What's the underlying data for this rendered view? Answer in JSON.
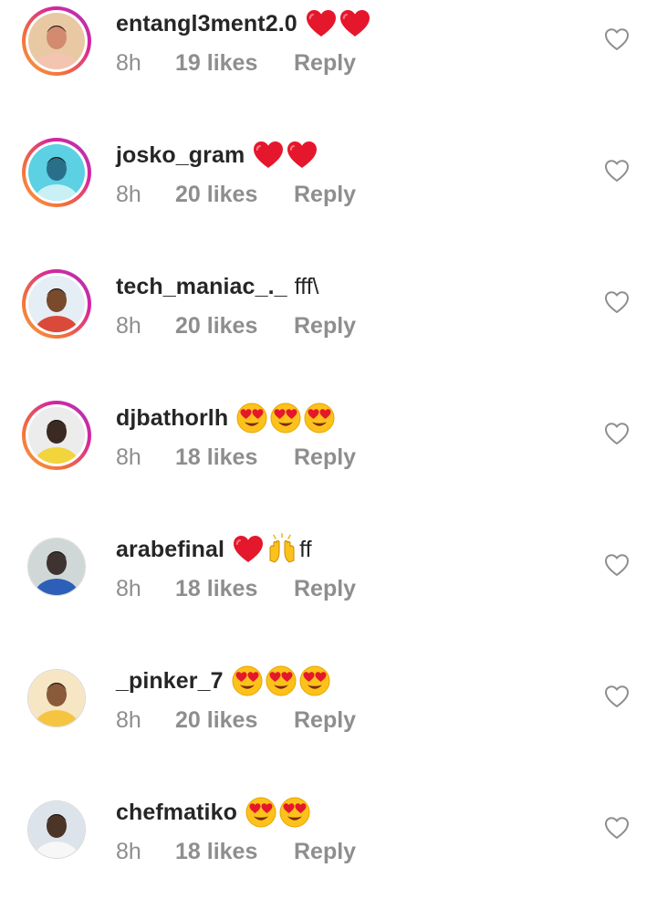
{
  "comments": [
    {
      "username": "entangl3ment2.0",
      "emojis": [
        "red-heart",
        "red-heart"
      ],
      "text_after": "",
      "time": "8h",
      "likes": "19 likes",
      "reply": "Reply",
      "story_ring": true,
      "avatar_colors": [
        "#e9c9a4",
        "#d28b6f",
        "#f3c5b0"
      ]
    },
    {
      "username": "josko_gram",
      "emojis": [
        "red-heart",
        "red-heart"
      ],
      "text_after": "",
      "time": "8h",
      "likes": "20 likes",
      "reply": "Reply",
      "story_ring": true,
      "avatar_colors": [
        "#5bd1e3",
        "#2a6f8a",
        "#c9f0f5"
      ]
    },
    {
      "username": "tech_maniac_._",
      "emojis": [],
      "text_after": "fff\\",
      "time": "8h",
      "likes": "20 likes",
      "reply": "Reply",
      "story_ring": true,
      "avatar_colors": [
        "#e6eef5",
        "#7a4a2c",
        "#d94a3a"
      ]
    },
    {
      "username": "djbathorlh",
      "emojis": [
        "heart-eyes-face",
        "heart-eyes-face",
        "heart-eyes-face"
      ],
      "text_after": "",
      "time": "8h",
      "likes": "18 likes",
      "reply": "Reply",
      "story_ring": true,
      "avatar_colors": [
        "#ececec",
        "#3b2a22",
        "#f2d43c"
      ]
    },
    {
      "username": "arabefinal",
      "emojis": [
        "red-heart",
        "raising-hands"
      ],
      "text_after": "ff",
      "time": "8h",
      "likes": "18 likes",
      "reply": "Reply",
      "story_ring": false,
      "avatar_colors": [
        "#cfd8d6",
        "#3d3330",
        "#2e5fb8"
      ]
    },
    {
      "username": "_pinker_7",
      "emojis": [
        "heart-eyes-face",
        "heart-eyes-face",
        "heart-eyes-face"
      ],
      "text_after": "",
      "time": "8h",
      "likes": "20 likes",
      "reply": "Reply",
      "story_ring": false,
      "avatar_colors": [
        "#f6e6c4",
        "#8a5a3b",
        "#f5c542"
      ]
    },
    {
      "username": "chefmatiko",
      "emojis": [
        "heart-eyes-face",
        "heart-eyes-face"
      ],
      "text_after": "",
      "time": "8h",
      "likes": "18 likes",
      "reply": "Reply",
      "story_ring": false,
      "avatar_colors": [
        "#dde3ea",
        "#4a3528",
        "#f7f7f7"
      ]
    }
  ]
}
